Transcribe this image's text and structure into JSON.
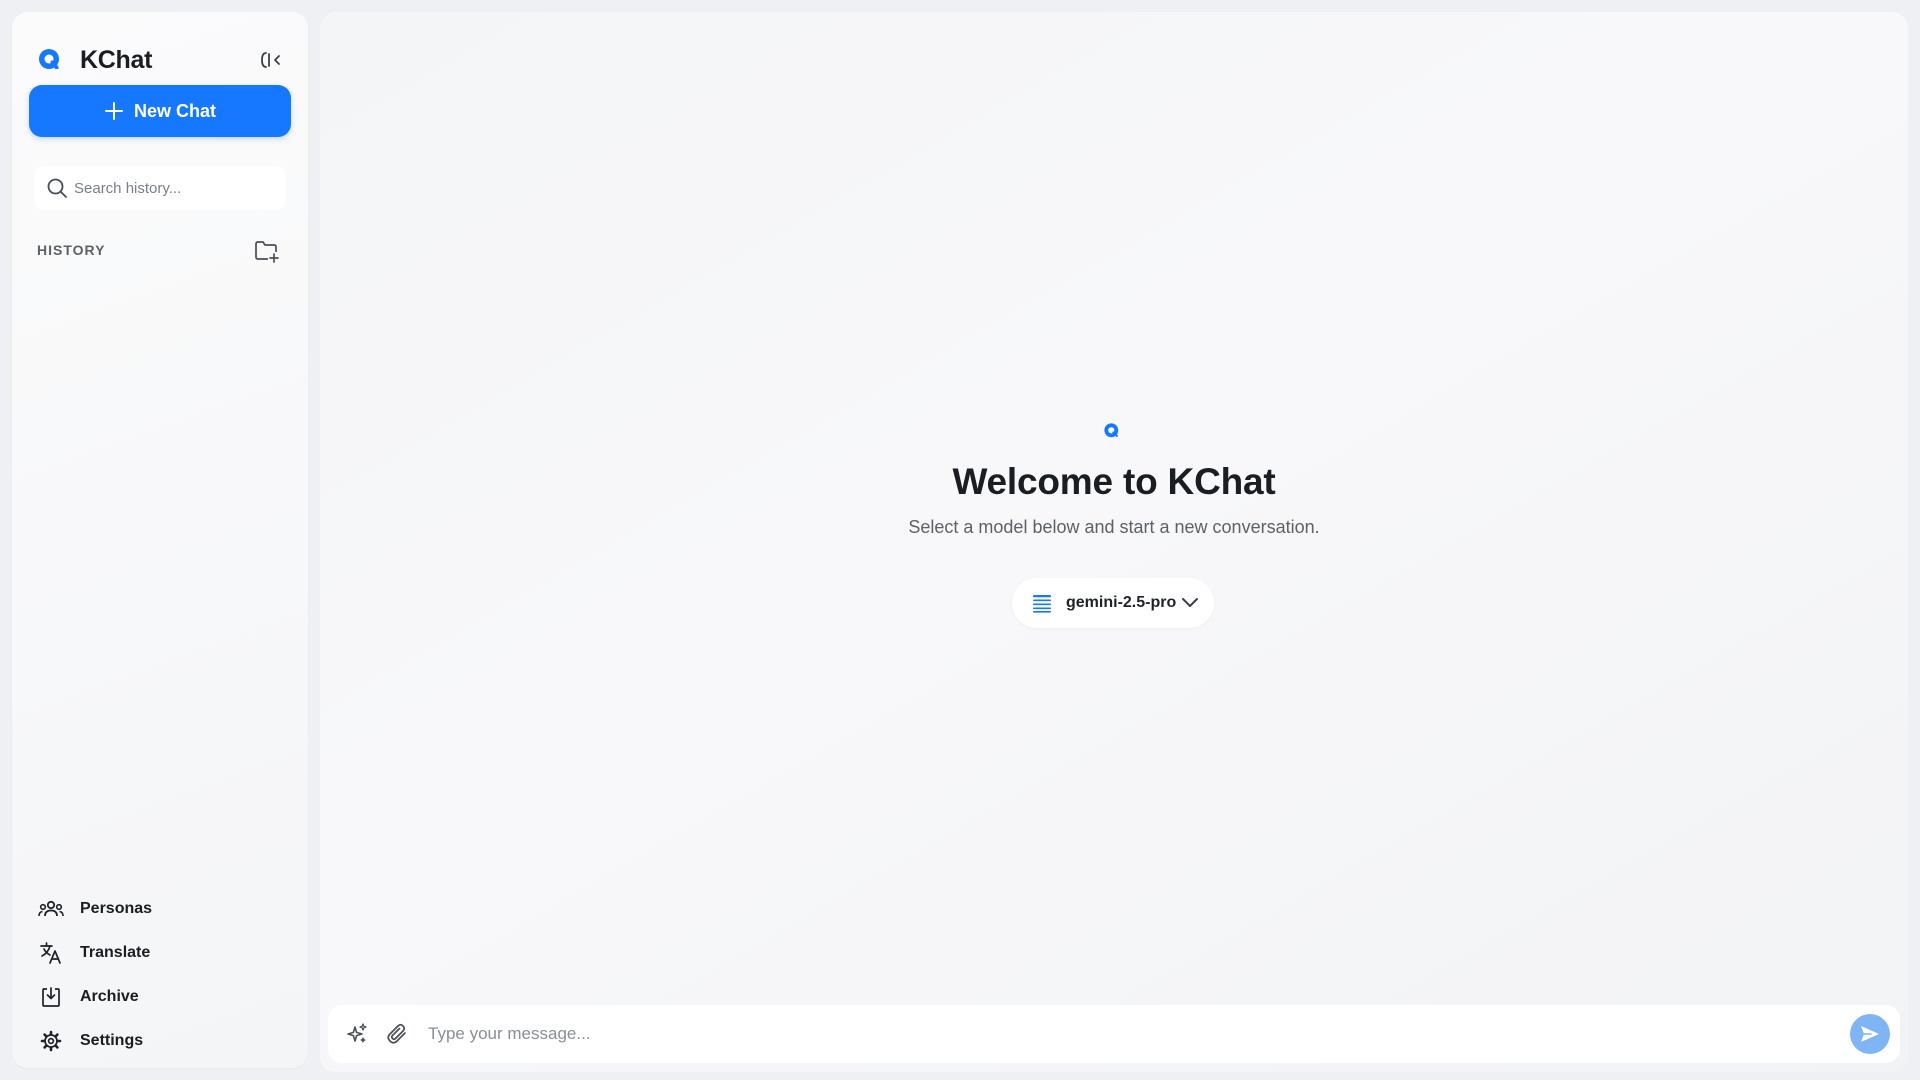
{
  "app": {
    "name": "KChat"
  },
  "sidebar": {
    "new_chat_label": "New Chat",
    "search_placeholder": "Search history...",
    "history_label": "HISTORY",
    "nav": [
      {
        "label": "Personas",
        "icon": "personas-icon"
      },
      {
        "label": "Translate",
        "icon": "translate-icon"
      },
      {
        "label": "Archive",
        "icon": "archive-icon"
      },
      {
        "label": "Settings",
        "icon": "settings-icon"
      }
    ]
  },
  "main": {
    "welcome_title": "Welcome to KChat",
    "welcome_subtitle": "Select a model below and start a new conversation.",
    "model": "gemini-2.5-pro",
    "composer_placeholder": "Type your message..."
  },
  "colors": {
    "accent": "#1677ff",
    "send_button": "#7fb4f5"
  }
}
